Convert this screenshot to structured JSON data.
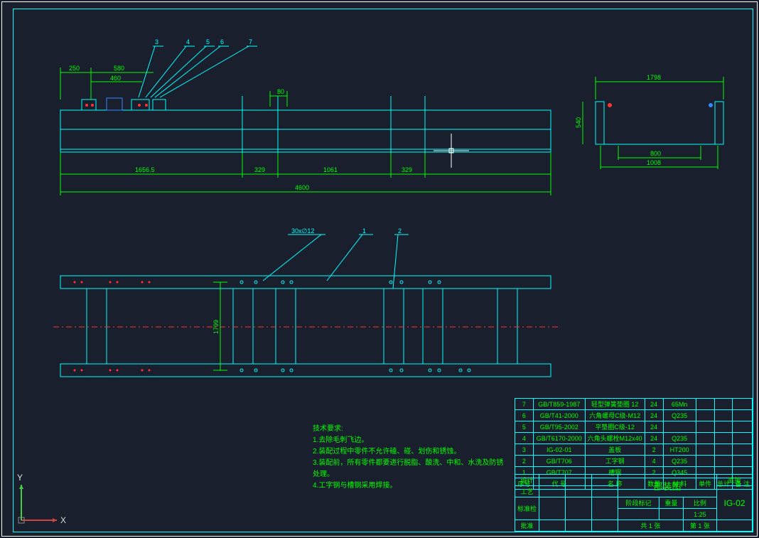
{
  "dimensions": {
    "d250": "250",
    "d580": "580",
    "d460": "460",
    "d80": "80",
    "d1656": "1656.5",
    "d329a": "329",
    "d1061": "1061",
    "d329b": "329",
    "d4600": "4600",
    "d540": "540",
    "d1798": "1798",
    "d800": "800",
    "d1008": "1008",
    "d1799": "1799",
    "d30x12": "30x∅12"
  },
  "callouts": {
    "c3": "3",
    "c4": "4",
    "c5": "5",
    "c6": "6",
    "c7": "7",
    "c1": "1",
    "c2": "2"
  },
  "notes": {
    "title": "技术要求:",
    "n1": "1.去除毛刺飞边。",
    "n2": "2.装配过程中零件不允许磕、碰、划伤和锈蚀。",
    "n3": "3.装配前，所有零件都要进行脱脂、酸洗、中和、水洗及防锈处理。",
    "n4": "4.工字钢与槽钢采用焊接。"
  },
  "parts": [
    {
      "n": "7",
      "std": "GB/T859-1987",
      "name": "轻型弹簧垫圈 12",
      "qty": "24",
      "mat": "65Mn"
    },
    {
      "n": "6",
      "std": "GB/T41-2000",
      "name": "六角螺母C级-M12",
      "qty": "24",
      "mat": "Q235"
    },
    {
      "n": "5",
      "std": "GB/T95-2002",
      "name": "平垫圈C级-12",
      "qty": "24",
      "mat": ""
    },
    {
      "n": "4",
      "std": "GB/T6170-2000",
      "name": "六角头螺栓M12x40",
      "qty": "24",
      "mat": "Q235"
    },
    {
      "n": "3",
      "std": "IG-02-01",
      "name": "盖板",
      "qty": "2",
      "mat": "HT200"
    },
    {
      "n": "2",
      "std": "GB/T706",
      "name": "工字钢",
      "qty": "4",
      "mat": "Q235"
    },
    {
      "n": "1",
      "std": "GB/T707",
      "name": "槽钢",
      "qty": "2",
      "mat": "Q345"
    }
  ],
  "headers": {
    "seq": "序号",
    "code": "代 号",
    "name": "名 称",
    "qty": "数量",
    "mat": "材 料",
    "uw": "单件",
    "tw": "总计",
    "note": "备 注"
  },
  "title_block": {
    "title": "部装图",
    "sub": "底架",
    "dwg": "IG-02",
    "scale": "1:25"
  },
  "tb_labels": {
    "design": "设计",
    "proc": "工艺",
    "appr": "审核",
    "std": "标准检",
    "apprv": "批准",
    "stage": "阶段标记",
    "wt": "重量",
    "sc": "比例",
    "sheet": "共 1 张",
    "pg": "第 1 张"
  },
  "ucs": {
    "x": "X",
    "y": "Y"
  }
}
